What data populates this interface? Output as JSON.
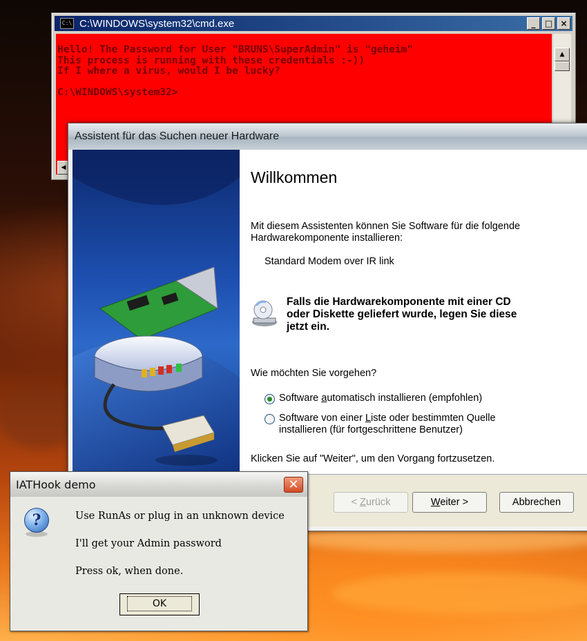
{
  "colors": {
    "console_bg": "#ff0000",
    "console_text": "#770000",
    "cmd_titlebar": "#0a246a",
    "wizard_banner": "#1d4fb0",
    "close_button": "#d34a25"
  },
  "cmd": {
    "title": "C:\\WINDOWS\\system32\\cmd.exe",
    "icon": "C:\\",
    "buttons": {
      "minimize": "_",
      "maximize": "□",
      "close": "×"
    },
    "lines": [
      "Hello! The Password for User \"BRUNS\\SuperAdmin\" is \"geheim\"",
      "This process is running with these credentials :-))",
      "If I where a virus, would I be lucky?",
      "",
      "C:\\WINDOWS\\system32>"
    ]
  },
  "wizard": {
    "title": "Assistent für das Suchen neuer Hardware",
    "heading": "Willkommen",
    "intro_line1": "Mit diesem Assistenten können Sie Software für die folgende",
    "intro_line2": "Hardwarekomponente installieren:",
    "device": "Standard Modem over IR link",
    "cd_notice_line1": "Falls die Hardwarekomponente mit einer CD",
    "cd_notice_line2": "oder Diskette geliefert wurde, legen Sie diese",
    "cd_notice_line3": "jetzt ein.",
    "question": "Wie möchten Sie vorgehen?",
    "option_auto_pre": "Software ",
    "option_auto_key": "a",
    "option_auto_post": "utomatisch installieren (empfohlen)",
    "option_list_pre": "Software von einer ",
    "option_list_key": "L",
    "option_list_post": "iste oder bestimmten Quelle",
    "option_list_line2": "installieren (für fortgeschrittene Benutzer)",
    "selected_option": "auto",
    "continue_hint": "Klicken Sie auf \"Weiter\", um den Vorgang fortzusetzen.",
    "back_pre": "< ",
    "back_key": "Z",
    "back_post": "urück",
    "next_key": "W",
    "next_post": "eiter >",
    "cancel": "Abbrechen"
  },
  "msgbox": {
    "title": "IATHook demo",
    "close": "✕",
    "icon": "question-icon",
    "icon_glyph": "?",
    "line1": "Use RunAs or plug in an unknown device",
    "line2": "I'll get your Admin password",
    "line3": "Press ok, when done.",
    "ok": "OK"
  }
}
